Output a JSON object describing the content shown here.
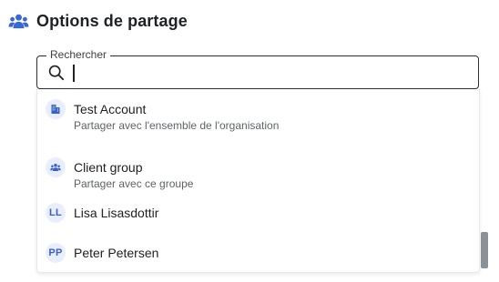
{
  "header": {
    "title": "Options de partage",
    "icon": "group-icon",
    "icon_color": "#3a67d8"
  },
  "search": {
    "label": "Rechercher",
    "value": "",
    "placeholder": "",
    "icon": "search-icon"
  },
  "options": [
    {
      "kind": "organization",
      "icon": "building-icon",
      "title": "Test Account",
      "subtitle": "Partager avec l'ensemble de l'organisation"
    },
    {
      "kind": "group",
      "icon": "group-icon",
      "title": "Client group",
      "subtitle": "Partager avec ce groupe"
    },
    {
      "kind": "user",
      "initials": "LL",
      "title": "Lisa Lisasdottir"
    },
    {
      "kind": "user",
      "initials": "PP",
      "title": "Peter Petersen"
    }
  ],
  "colors": {
    "accent": "#3a67d8",
    "avatar_bg": "#e8eefb",
    "text_primary": "#202124",
    "text_secondary": "#5f6368"
  }
}
